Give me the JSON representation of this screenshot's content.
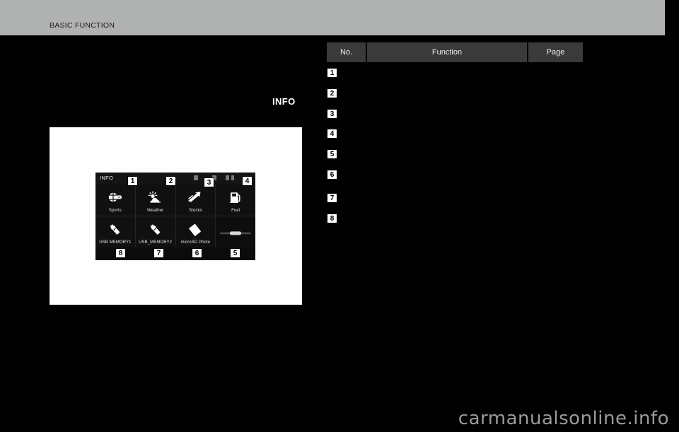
{
  "header": {
    "running_head": "BASIC FUNCTION"
  },
  "figure": {
    "caption": "INFO",
    "screen": {
      "title": "INFO",
      "status_icons": [
        "clock-icon",
        "sd-card-icon",
        "signal-icon",
        "bluetooth-icon"
      ],
      "tiles": [
        {
          "label": "Sports",
          "icon": "sports-ball-icon",
          "callout": "1"
        },
        {
          "label": "Weather",
          "icon": "weather-sun-cloud-icon",
          "callout": "2"
        },
        {
          "label": "Stocks",
          "icon": "stocks-arrow-icon",
          "callout": "3"
        },
        {
          "label": "Fuel",
          "icon": "fuel-pump-icon",
          "callout": "4"
        },
        {
          "label": "USB MEMORY1",
          "icon": "usb-memory-icon",
          "callout": "8"
        },
        {
          "label": "USB_MEMORY2",
          "icon": "usb-memory-icon",
          "callout": "7"
        },
        {
          "label": "microSD Photo",
          "icon": "sd-card-icon",
          "callout": "6"
        },
        {
          "label": "",
          "icon": "scroll-bar-icon",
          "callout": "5"
        }
      ]
    }
  },
  "table": {
    "columns": [
      "No.",
      "Function",
      "Page"
    ],
    "rows": [
      {
        "no": "1",
        "function": "",
        "page": ""
      },
      {
        "no": "2",
        "function": "",
        "page": ""
      },
      {
        "no": "3",
        "function": "",
        "page": ""
      },
      {
        "no": "4",
        "function": "",
        "page": ""
      },
      {
        "no": "5",
        "function": "",
        "page": ""
      },
      {
        "no": "6",
        "function": "",
        "page": ""
      },
      {
        "no": "7",
        "function": "",
        "page": ""
      },
      {
        "no": "8",
        "function": "",
        "page": ""
      }
    ]
  },
  "watermark": {
    "text": "carmanualsonline.info"
  },
  "colors": {
    "page_background": "#000000",
    "header_bar": "#b0b1b1",
    "table_header": "#3a3a3a",
    "figure_panel": "#ffffff",
    "screen_background": "#0b0b0b",
    "watermark": "#9a9a9a"
  }
}
